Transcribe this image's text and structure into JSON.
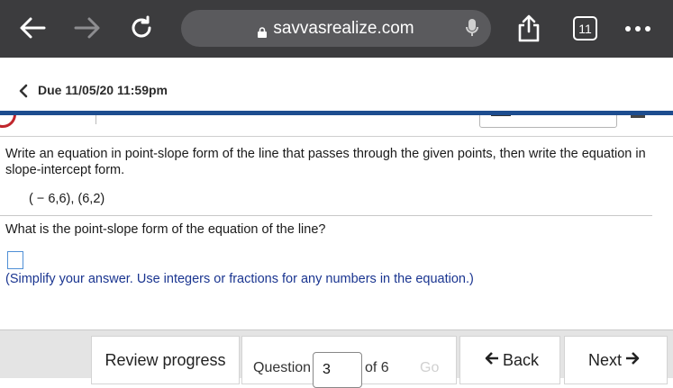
{
  "browser": {
    "url": "savvasrealize.com",
    "tab_count": "11",
    "icons": [
      "back-arrow-icon",
      "forward-arrow-icon",
      "reload-icon",
      "lock-icon",
      "microphone-icon",
      "share-icon",
      "tabs-icon",
      "more-icon"
    ]
  },
  "header": {
    "due_text": "Due 11/05/20 11:59pm"
  },
  "question": {
    "instruction": "Write an equation in point-slope form of the line that passes through the given points, then write  the equation in slope-intercept form.",
    "points": "( − 6,6), (6,2)",
    "prompt": "What is the point-slope form of the equation of the line?",
    "answer_value": "",
    "hint": "(Simplify your answer. Use integers or fractions for any numbers in the equation.)"
  },
  "footer": {
    "review_label": "Review progress",
    "question_label": "Question",
    "question_number": "3",
    "of_label": "of 6",
    "go_label": "Go",
    "back_label": "Back",
    "next_label": "Next"
  },
  "colors": {
    "chrome_bg": "#3c3c3e",
    "url_pill": "#5a5a5d",
    "accent_blue": "#1d4d8f",
    "hint_blue": "#1a3590",
    "logo_red": "#c0262c"
  }
}
